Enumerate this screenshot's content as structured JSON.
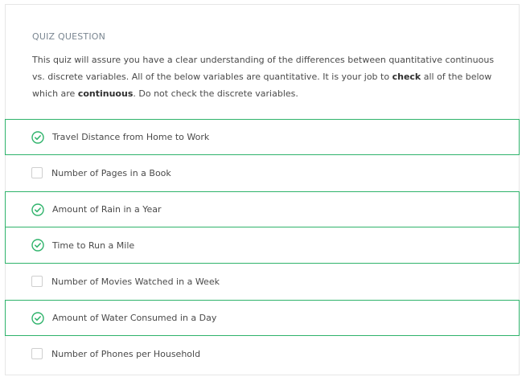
{
  "quiz": {
    "section_label": "QUIZ QUESTION",
    "prompt": {
      "part1": "This quiz will assure you have a clear understanding of the differences between quantitative continuous vs. discrete variables. All of the below variables are quantitative. It is your job to ",
      "bold1": "check",
      "part2": " all of the below which are ",
      "bold2": "continuous",
      "part3": ". Do not check the discrete variables."
    },
    "options": [
      {
        "label": "Travel Distance from Home to Work",
        "checked": true
      },
      {
        "label": "Number of Pages in a Book",
        "checked": false
      },
      {
        "label": "Amount of Rain in a Year",
        "checked": true
      },
      {
        "label": "Time to Run a Mile",
        "checked": true
      },
      {
        "label": "Number of Movies Watched in a Week",
        "checked": false
      },
      {
        "label": "Amount of Water Consumed in a Day",
        "checked": true
      },
      {
        "label": "Number of Phones per Household",
        "checked": false
      }
    ]
  },
  "colors": {
    "accent": "#2fb36b",
    "border": "#e6e6e6",
    "label_gray": "#7a8691"
  }
}
